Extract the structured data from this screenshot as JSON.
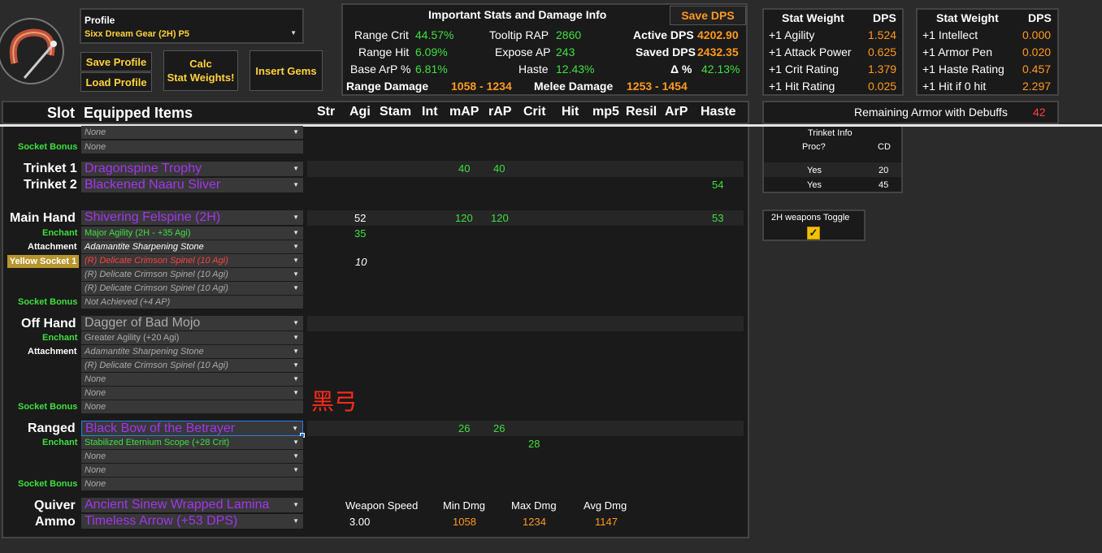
{
  "profile": {
    "label": "Profile",
    "value": "Sixx Dream Gear (2H) P5"
  },
  "buttons": {
    "save_profile": "Save Profile",
    "load_profile": "Load Profile",
    "calc_line1": "Calc",
    "calc_line2": "Stat Weights!",
    "insert_gems": "Insert Gems",
    "save_dps": "Save DPS"
  },
  "stats": {
    "title": "Important Stats and Damage Info",
    "range_crit_label": "Range Crit",
    "range_crit": "44.57%",
    "range_hit_label": "Range Hit",
    "range_hit": "6.09%",
    "base_arp_label": "Base ArP %",
    "base_arp": "6.81%",
    "tooltip_rap_label": "Tooltip RAP",
    "tooltip_rap": "2860",
    "expose_ap_label": "Expose AP",
    "expose_ap": "243",
    "haste_label": "Haste",
    "haste": "12.43%",
    "active_dps_label": "Active DPS",
    "active_dps": "4202.90",
    "saved_dps_label": "Saved DPS",
    "saved_dps": "2432.35",
    "delta_label": "Δ %",
    "delta": "42.13%",
    "range_damage_label": "Range Damage",
    "range_damage": "1058 - 1234",
    "melee_damage_label": "Melee Damage",
    "melee_damage": "1253 - 1454"
  },
  "weights_left": {
    "h1": "Stat Weight",
    "h2": "DPS",
    "rows": [
      {
        "s": "+1 Agility",
        "v": "1.524"
      },
      {
        "s": "+1 Attack Power",
        "v": "0.625"
      },
      {
        "s": "+1 Crit Rating",
        "v": "1.379"
      },
      {
        "s": "+1 Hit Rating",
        "v": "0.025"
      }
    ]
  },
  "weights_right": {
    "h1": "Stat Weight",
    "h2": "DPS",
    "rows": [
      {
        "s": "+1 Intellect",
        "v": "0.000"
      },
      {
        "s": "+1 Armor Pen",
        "v": "0.020"
      },
      {
        "s": "+1 Haste Rating",
        "v": "0.457"
      },
      {
        "s": "+1 Hit if 0 hit",
        "v": "2.297"
      }
    ]
  },
  "armor": {
    "label": "Remaining Armor with Debuffs",
    "value": "42"
  },
  "columns": {
    "slot": "Slot",
    "items": "Equipped Items",
    "str": "Str",
    "agi": "Agi",
    "stam": "Stam",
    "int": "Int",
    "map": "mAP",
    "rap": "rAP",
    "crit": "Crit",
    "hit": "Hit",
    "mp5": "mp5",
    "resil": "Resil",
    "arp": "ArP",
    "haste": "Haste"
  },
  "rows": {
    "top_none": "None",
    "top_socket_bonus_label": "Socket Bonus",
    "top_socket_bonus": "None",
    "trinket1_label": "Trinket 1",
    "trinket1": "Dragonspine Trophy",
    "trinket1_map": "40",
    "trinket1_rap": "40",
    "trinket2_label": "Trinket 2",
    "trinket2": "Blackened Naaru Sliver",
    "trinket2_haste": "54",
    "main_label": "Main Hand",
    "main": "Shivering Felspine (2H)",
    "main_agi": "52",
    "main_map": "120",
    "main_rap": "120",
    "main_haste": "53",
    "main_enchant_label": "Enchant",
    "main_enchant": "Major Agility (2H - +35 Agi)",
    "main_enchant_agi": "35",
    "main_attach_label": "Attachment",
    "main_attach": "Adamantite Sharpening Stone",
    "main_socket_label": "Yellow Socket 1",
    "main_socket1": "(R) Delicate Crimson Spinel (10 Agi)",
    "main_socket1_agi": "10",
    "main_socket2": "(R) Delicate Crimson Spinel (10 Agi)",
    "main_socket3": "(R) Delicate Crimson Spinel (10 Agi)",
    "main_bonus_label": "Socket Bonus",
    "main_bonus": "Not Achieved (+4 AP)",
    "off_label": "Off Hand",
    "off": "Dagger of Bad Mojo",
    "off_enchant_label": "Enchant",
    "off_enchant": "Greater Agility (+20 Agi)",
    "off_attach_label": "Attachment",
    "off_attach": "Adamantite Sharpening Stone",
    "off_socket1": "(R) Delicate Crimson Spinel (10 Agi)",
    "off_socket2": "None",
    "off_socket3": "None",
    "off_bonus_label": "Socket Bonus",
    "off_bonus": "None",
    "annotation": "黑弓",
    "ranged_label": "Ranged",
    "ranged": "Black Bow of the Betrayer",
    "ranged_map": "26",
    "ranged_rap": "26",
    "ranged_enchant_label": "Enchant",
    "ranged_enchant": "Stabilized Eternium Scope (+28 Crit)",
    "ranged_enchant_crit": "28",
    "ranged_socket1": "None",
    "ranged_socket2": "None",
    "ranged_bonus_label": "Socket Bonus",
    "ranged_bonus": "None",
    "quiver_label": "Quiver",
    "quiver": "Ancient Sinew Wrapped Lamina",
    "ammo_label": "Ammo",
    "ammo": "Timeless Arrow (+53 DPS)"
  },
  "weapon": {
    "speed_label": "Weapon Speed",
    "min_label": "Min Dmg",
    "max_label": "Max Dmg",
    "avg_label": "Avg Dmg",
    "speed": "3.00",
    "min": "1058",
    "max": "1234",
    "avg": "1147"
  },
  "trinket_info": {
    "title": "Trinket Info",
    "proc": "Proc?",
    "cd": "CD",
    "r1_proc": "Yes",
    "r1_cd": "20",
    "r2_proc": "Yes",
    "r2_cd": "45"
  },
  "toggle": {
    "label": "2H weapons Toggle",
    "checked": true
  }
}
